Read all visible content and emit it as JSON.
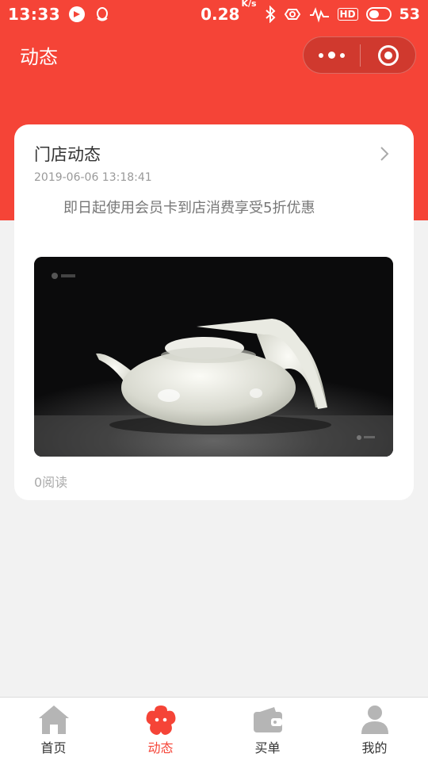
{
  "status_bar": {
    "time": "13:33",
    "speed": "0.28",
    "speed_unit": "K/s",
    "network_label": "HD",
    "battery": "53",
    "battery_level": 0.53
  },
  "nav": {
    "title": "动态"
  },
  "post": {
    "title": "门店动态",
    "date": "2019-06-06 13:18:41",
    "description": "即日起使用会员卡到店消费享受5折优惠",
    "reads": "0阅读"
  },
  "tabs": [
    {
      "label": "首页",
      "icon": "home-icon",
      "active": false
    },
    {
      "label": "动态",
      "icon": "flower-icon",
      "active": true
    },
    {
      "label": "买单",
      "icon": "wallet-icon",
      "active": false
    },
    {
      "label": "我的",
      "icon": "user-icon",
      "active": false
    }
  ],
  "colors": {
    "brand": "#f54437",
    "inactive_icon": "#b5b5b5",
    "background": "#f2f2f2"
  }
}
